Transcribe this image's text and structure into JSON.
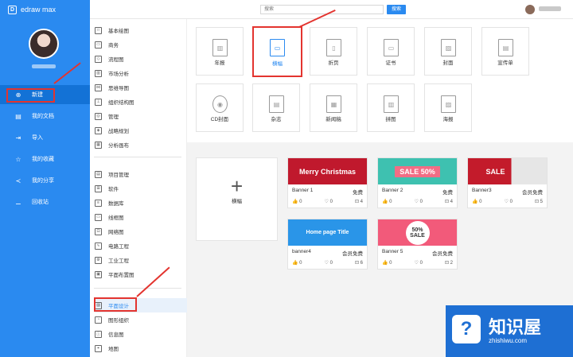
{
  "app": {
    "title": "edraw max"
  },
  "search": {
    "placeholder": "搜索",
    "button": "搜索"
  },
  "sidebar": {
    "items": [
      {
        "label": "新建",
        "icon": "plus-icon"
      },
      {
        "label": "我的文档",
        "icon": "document-icon"
      },
      {
        "label": "导入",
        "icon": "import-icon"
      },
      {
        "label": "我的收藏",
        "icon": "star-icon"
      },
      {
        "label": "我的分享",
        "icon": "share-icon"
      },
      {
        "label": "回收站",
        "icon": "trash-icon"
      }
    ]
  },
  "categories": {
    "group1": [
      "基本绘图",
      "商务",
      "流程图",
      "市场分析",
      "思维导图",
      "组织结构图",
      "管理",
      "战略规划",
      "分析画布"
    ],
    "group2": [
      "项目管理",
      "软件",
      "数据库",
      "线框图",
      "网络图",
      "电路工程",
      "工业工程",
      "平面布置图"
    ],
    "group3": [
      "平面设计",
      "图形组织",
      "信息图",
      "地图"
    ]
  },
  "templates": [
    "年报",
    "横幅",
    "折页",
    "证书",
    "封面",
    "宣传单",
    "CD封面",
    "杂志",
    "新闻稿",
    "拼图",
    "海报"
  ],
  "blank": {
    "label": "横幅"
  },
  "cards": [
    {
      "name": "Banner 1",
      "tag": "免费",
      "likes": "0",
      "favs": "0",
      "uses": "4",
      "thumb_text": "Merry Christmas",
      "color": "#c0192d"
    },
    {
      "name": "Banner 2",
      "tag": "免费",
      "likes": "0",
      "favs": "0",
      "uses": "4",
      "thumb_text": "SALE 50%",
      "color": "#3ec1b0"
    },
    {
      "name": "Banner3",
      "tag": "会员免费",
      "likes": "0",
      "favs": "0",
      "uses": "5",
      "thumb_text": "SALE",
      "color": "#c31b2b"
    },
    {
      "name": "banner4",
      "tag": "会员免费",
      "likes": "0",
      "favs": "0",
      "uses": "6",
      "thumb_text": "Home page Title",
      "color": "#2a95e8"
    },
    {
      "name": "Banner 5",
      "tag": "会员免费",
      "likes": "0",
      "favs": "0",
      "uses": "2",
      "thumb_text": "50% SALE",
      "color": "#f25a7a"
    }
  ],
  "watermark": {
    "title": "知识屋",
    "sub": "zhishiwu.com",
    "badge": "?"
  },
  "colors": {
    "primary": "#2a8af0",
    "highlight": "#e3342f"
  }
}
